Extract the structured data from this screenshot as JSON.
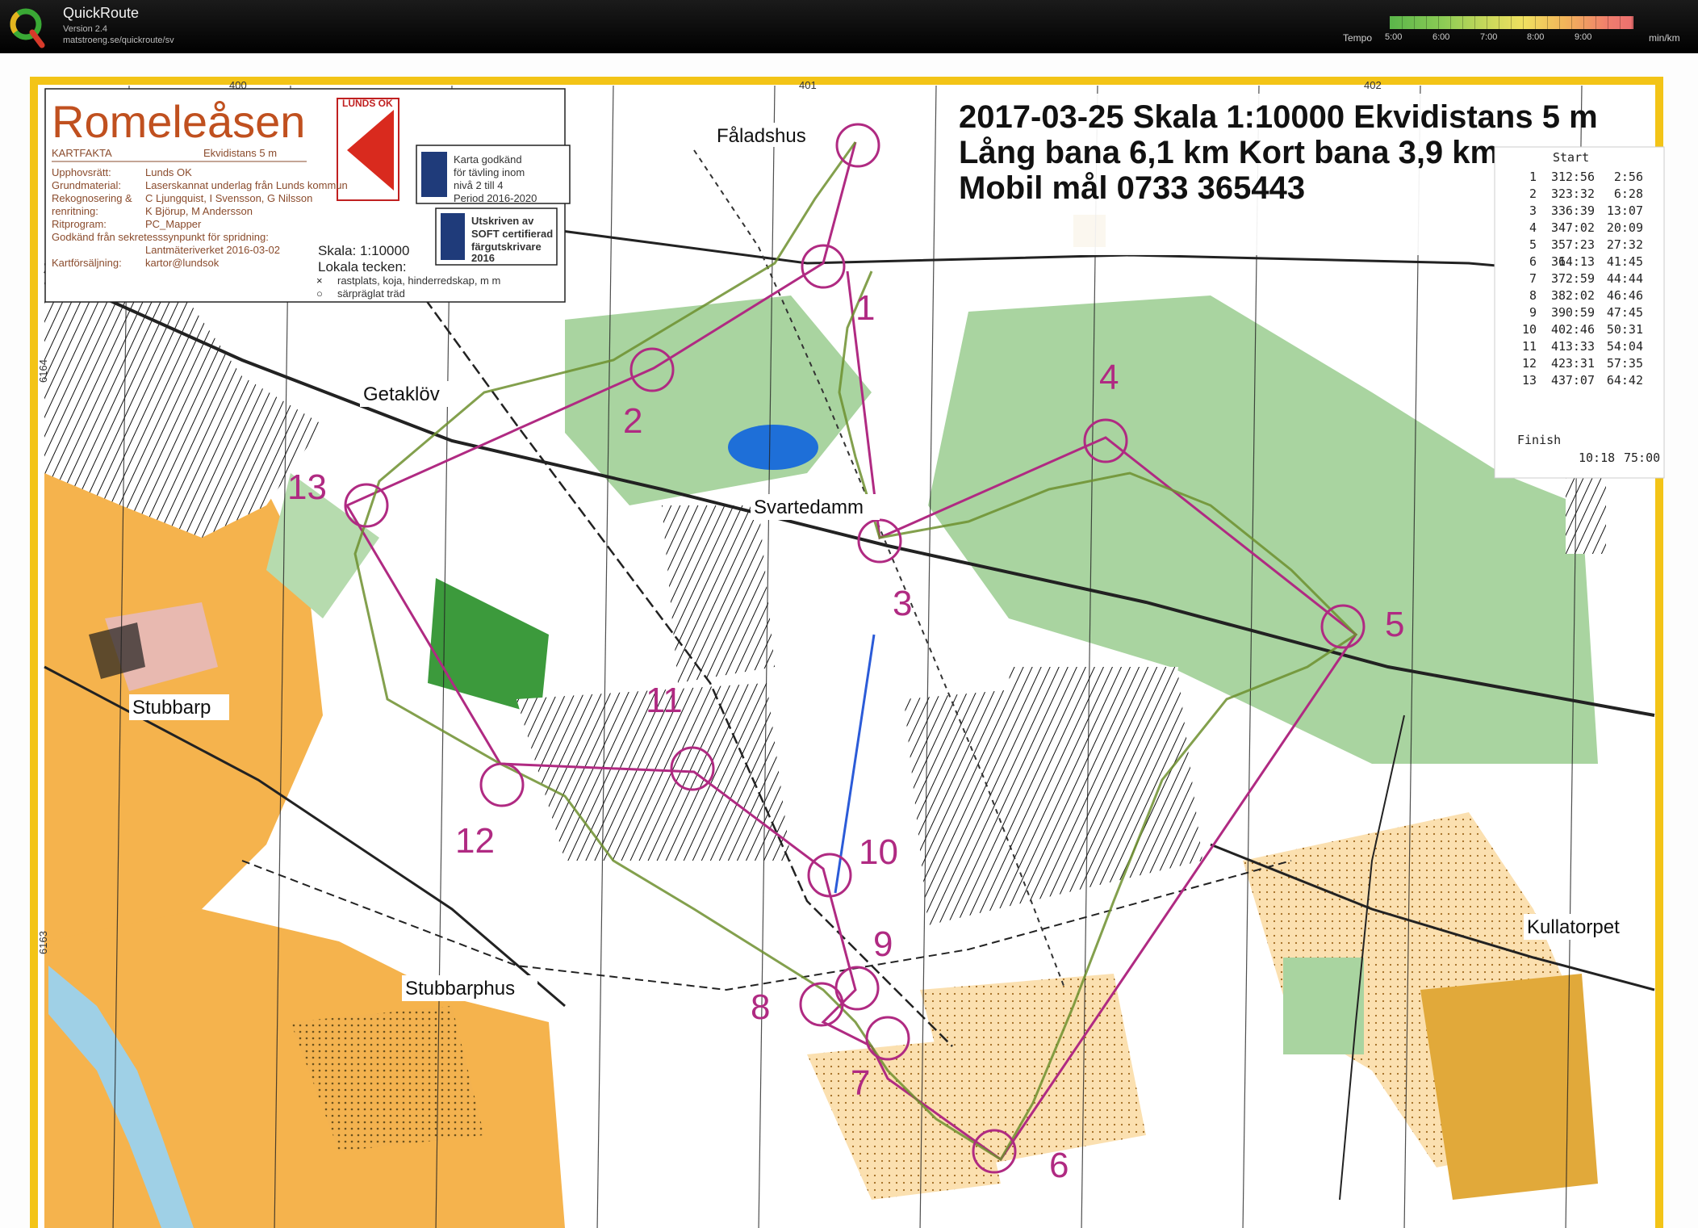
{
  "app": {
    "title": "QuickRoute",
    "version": "Version 2.4",
    "url": "matstroeng.se/quickroute/sv",
    "tempo_label": "Tempo",
    "tempo_unit": "min/km",
    "tempo_ticks": [
      "5:00",
      "6:00",
      "7:00",
      "8:00",
      "9:00"
    ]
  },
  "map": {
    "header_line1": "2017-03-25  Skala 1:10000  Ekvidistans 5 m",
    "header_line2": "Lång bana 6,1 km  Kort bana 3,9 km",
    "header_line3": "Mobil mål  0733 365443",
    "title": "Romeleåsen",
    "club_logo_text": "LUNDS OK",
    "kartfakta": "KARTFAKTA",
    "ekvidistans": "Ekvidistans 5 m",
    "facts_left": [
      "Upphovsrätt:",
      "Grundmaterial:",
      "Rekognosering &",
      "renritning:",
      "Ritprogram:",
      "Godkänd från sekretesssynpunkt för spridning:",
      "Kartförsäljning:"
    ],
    "facts_right": [
      "Lunds OK",
      "Laserskannat underlag från Lunds kommun",
      "C Ljungquist, I Svensson, G Nilsson",
      "K Björup, M Andersson",
      "PC_Mapper",
      "Lantmäteriverket 2016-03-02",
      "kartor@lundsok"
    ],
    "scale_box": "Skala: 1:10000",
    "local_symbols": "Lokala tecken:",
    "local_1": "rastplats, koja, hinderredskap, m m",
    "local_2": "särpräglat träd",
    "approval_1": "Karta godkänd",
    "approval_2": "för tävling inom",
    "approval_3": "nivå 2 till 4",
    "approval_4": "Period 2016-2020",
    "soft_1": "Utskriven av",
    "soft_2": "SOFT certifierad",
    "soft_3": "färgutskrivare",
    "soft_4": "2016",
    "grid_labels": [
      "400",
      "401",
      "402",
      "6164",
      "6163"
    ],
    "places": [
      "Fåladshus",
      "Getaklöv",
      "Svartedamm",
      "Stubbarp",
      "Stubbarphus",
      "Kullatorpet"
    ],
    "controls": [
      "1",
      "2",
      "3",
      "4",
      "5",
      "6",
      "7",
      "8",
      "9",
      "10",
      "11",
      "12",
      "13"
    ],
    "splits_header": "Start",
    "splits": [
      {
        "leg": "1",
        "code": "31",
        "leg_time": "2:56",
        "total": "2:56"
      },
      {
        "leg": "2",
        "code": "32",
        "leg_time": "3:32",
        "total": "6:28"
      },
      {
        "leg": "3",
        "code": "33",
        "leg_time": "6:39",
        "total": "13:07"
      },
      {
        "leg": "4",
        "code": "34",
        "leg_time": "7:02",
        "total": "20:09"
      },
      {
        "leg": "5",
        "code": "35",
        "leg_time": "7:23",
        "total": "27:32"
      },
      {
        "leg": "6",
        "code": "36",
        "leg_time": "14:13",
        "total": "41:45"
      },
      {
        "leg": "7",
        "code": "37",
        "leg_time": "2:59",
        "total": "44:44"
      },
      {
        "leg": "8",
        "code": "38",
        "leg_time": "2:02",
        "total": "46:46"
      },
      {
        "leg": "9",
        "code": "39",
        "leg_time": "0:59",
        "total": "47:45"
      },
      {
        "leg": "10",
        "code": "40",
        "leg_time": "2:46",
        "total": "50:31"
      },
      {
        "leg": "11",
        "code": "41",
        "leg_time": "3:33",
        "total": "54:04"
      },
      {
        "leg": "12",
        "code": "42",
        "leg_time": "3:31",
        "total": "57:35"
      },
      {
        "leg": "13",
        "code": "43",
        "leg_time": "7:07",
        "total": "64:42"
      }
    ],
    "finish_label": "Finish",
    "finish_leg": "10:18",
    "finish_total": "75:00"
  }
}
